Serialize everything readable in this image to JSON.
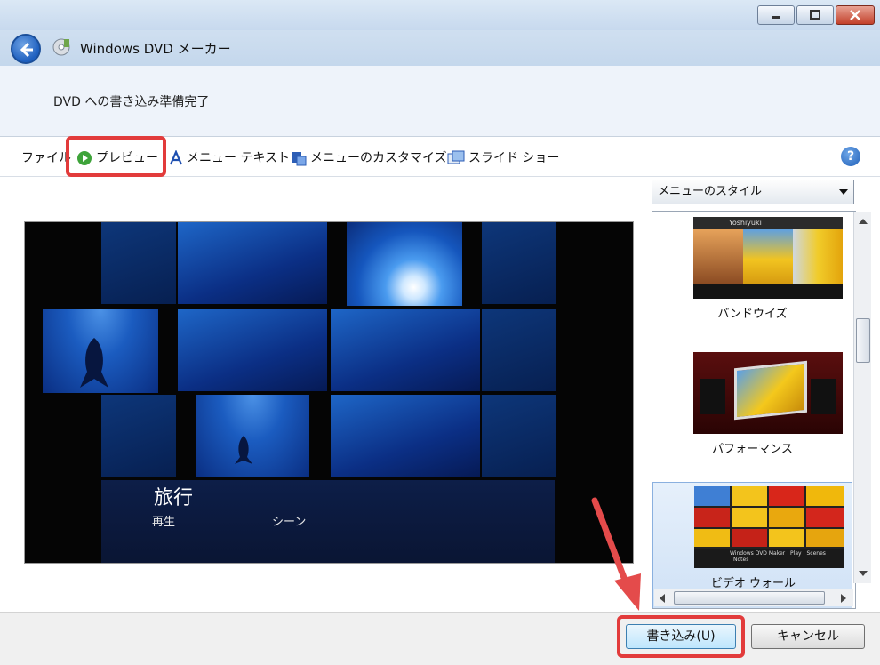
{
  "window": {
    "title": "Windows DVD メーカー",
    "controls": [
      "minimize",
      "maximize",
      "close"
    ]
  },
  "status": {
    "text": "DVD への書き込み準備完了"
  },
  "toolbar": {
    "file": "ファイル",
    "preview": "プレビュー",
    "menu_text": "メニュー テキスト",
    "customize_menu": "メニューのカスタマイズ",
    "slideshow": "スライド ショー"
  },
  "preview": {
    "menu_title": "旅行",
    "play": "再生",
    "scenes": "シーン"
  },
  "styles": {
    "dropdown_value": "メニューのスタイル",
    "items": [
      {
        "label": "バンドウイズ",
        "icon": "band-wide-thumbnail"
      },
      {
        "label": "パフォーマンス",
        "icon": "performance-thumbnail"
      },
      {
        "label": "ビデオ ウォール",
        "icon": "video-wall-thumbnail",
        "selected": true
      }
    ],
    "thumb_texts": {
      "band_caption": "Yoshiyuki",
      "wall_captions": [
        "Windows DVD Maker",
        "Play",
        "Scenes",
        "Notes"
      ]
    }
  },
  "footer": {
    "burn_button": "書き込み(U)",
    "cancel_button": "キャンセル"
  },
  "colors": {
    "highlight": "#e23b3b",
    "accent": "#1d5fbf"
  }
}
